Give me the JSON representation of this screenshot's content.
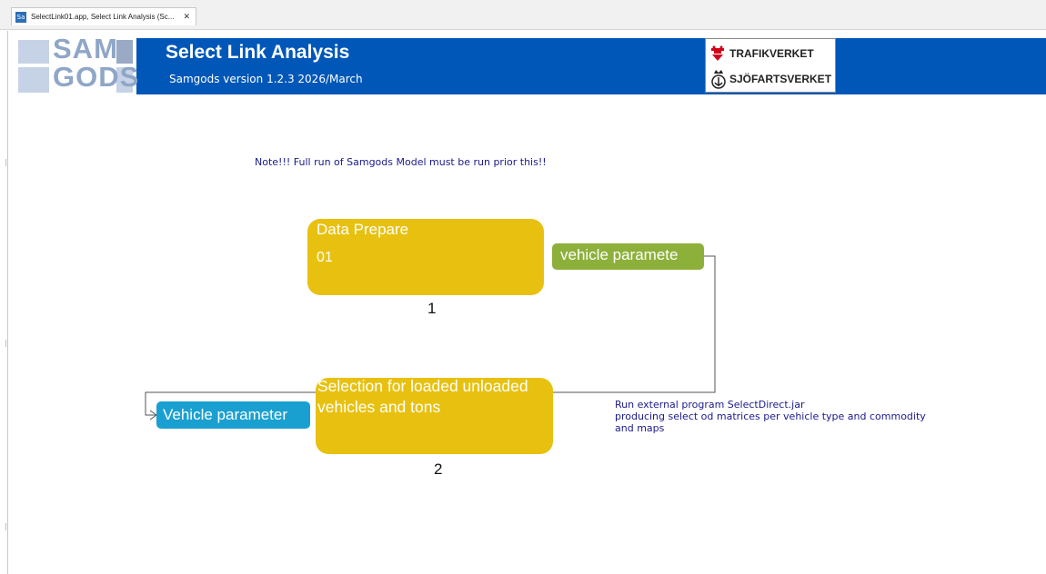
{
  "tab": {
    "icon_text": "Sa",
    "title": "SelectLink01.app, Select Link Analysis (Sc...",
    "close_glyph": "✕"
  },
  "banner": {
    "logo_text": "SAM GODS",
    "title": "Select Link Analysis",
    "subtitle": "Samgods version 1.2.3 2026/March",
    "background": "#0057b8",
    "partners": [
      {
        "name": "TRAFIKVERKET",
        "icon": "trafikverket-crest-icon"
      },
      {
        "name": "SJÖFARTSVERKET",
        "icon": "anchor-crown-icon"
      }
    ]
  },
  "note": "Note!!! Full run of Samgods Model must be run prior this!!",
  "flow": {
    "node1": {
      "title": "Data Prepare",
      "sub": "01",
      "number": "1",
      "color": "#e8c110"
    },
    "param_out": {
      "label": "vehicle paramete",
      "color": "#8db03b"
    },
    "node2": {
      "title": "Selection for loaded unloaded vehicles and tons",
      "number": "2",
      "color": "#e8c110"
    },
    "param_in": {
      "label": "Vehicle parameter",
      "color": "#1aa0d0"
    },
    "description": [
      "Run external program SelectDirect.jar",
      "producing select od matrices per vehicle type and commodity",
      "and maps"
    ]
  }
}
